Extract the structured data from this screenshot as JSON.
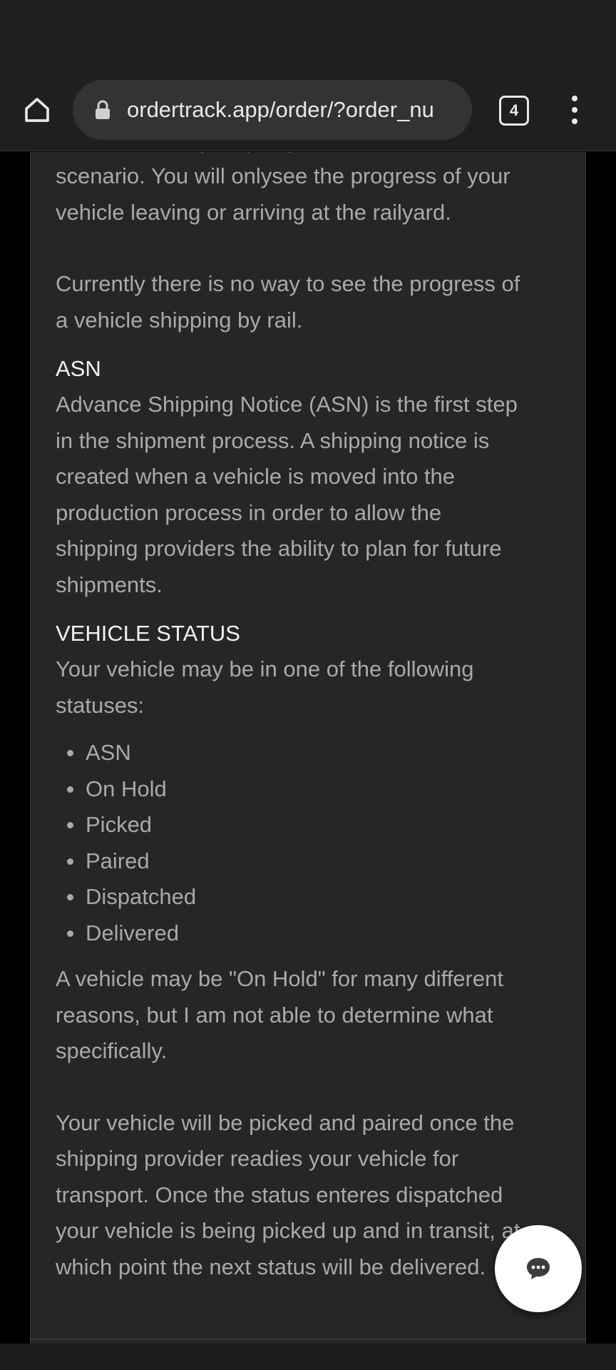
{
  "browser": {
    "url": "ordertrack.app/order/?order_nu",
    "tab_count": "4"
  },
  "article": {
    "partial_top_line": "information only ships by rail in this",
    "para1_lines": [
      "scenario. You will onlysee the progress of your",
      "vehicle leaving or arriving at the railyard."
    ],
    "para2_lines": [
      "Currently there is no way to see the progress of",
      "a vehicle shipping by rail."
    ],
    "asn_heading": "ASN",
    "asn_lines": [
      "Advance Shipping Notice (ASN) is the first step",
      "in the shipment process. A shipping notice is",
      "created when a vehicle is moved into the",
      "production process in order to allow the",
      "shipping providers the ability to plan for future",
      "shipments."
    ],
    "status_heading": "VEHICLE STATUS",
    "status_intro_lines": [
      "Your vehicle may be in one of the following",
      "statuses:"
    ],
    "statuses": [
      "ASN",
      "On Hold",
      "Picked",
      "Paired",
      "Dispatched",
      "Delivered"
    ],
    "hold_lines": [
      "A vehicle may be \"On Hold\" for many different",
      "reasons, but I am not able to determine what",
      "specifically."
    ],
    "final_lines": [
      "Your vehicle will be picked and paired once the",
      "shipping provider readies your vehicle for",
      "transport. Once the status enteres dispatched",
      "your vehicle is being picked up and in transit, at",
      "which point the next status will be delivered."
    ]
  }
}
